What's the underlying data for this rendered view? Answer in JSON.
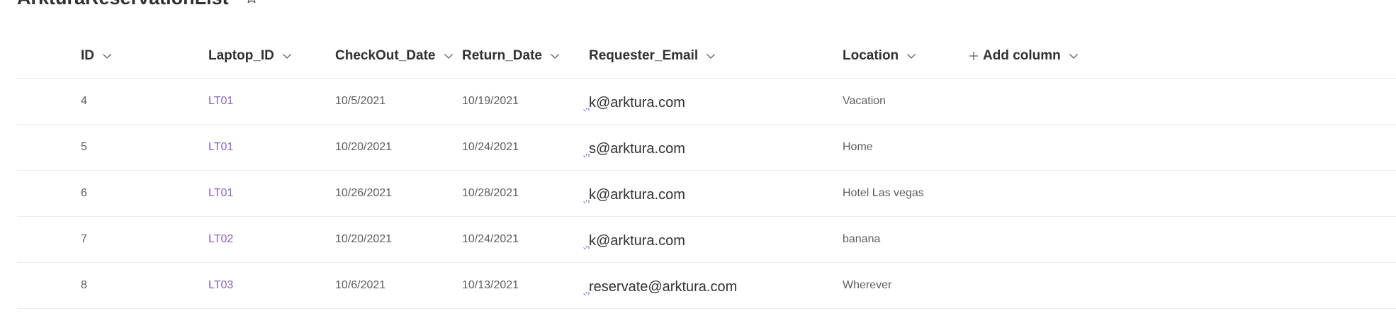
{
  "list": {
    "title": "ArkturaReservationList"
  },
  "columns": {
    "id": "ID",
    "laptop_id": "Laptop_ID",
    "checkout_date": "CheckOut_Date",
    "return_date": "Return_Date",
    "requester_email": "Requester_Email",
    "location": "Location",
    "add_column": "Add column"
  },
  "rows": [
    {
      "id": "4",
      "laptop_id": "LT01",
      "checkout_date": "10/5/2021",
      "return_date": "10/19/2021",
      "requester_email": "k@arktura.com",
      "location": "Vacation"
    },
    {
      "id": "5",
      "laptop_id": "LT01",
      "checkout_date": "10/20/2021",
      "return_date": "10/24/2021",
      "requester_email": "s@arktura.com",
      "location": "Home"
    },
    {
      "id": "6",
      "laptop_id": "LT01",
      "checkout_date": "10/26/2021",
      "return_date": "10/28/2021",
      "requester_email": "k@arktura.com",
      "location": "Hotel Las vegas"
    },
    {
      "id": "7",
      "laptop_id": "LT02",
      "checkout_date": "10/20/2021",
      "return_date": "10/24/2021",
      "requester_email": "k@arktura.com",
      "location": "banana"
    },
    {
      "id": "8",
      "laptop_id": "LT03",
      "checkout_date": "10/6/2021",
      "return_date": "10/13/2021",
      "requester_email": "reservate@arktura.com",
      "location": "Wherever"
    }
  ],
  "colors": {
    "accent": "#8764b8",
    "text_primary": "#323130",
    "text_secondary": "#605e5c",
    "divider": "#edebe9"
  },
  "icons": {
    "favorite": "star-outline-icon",
    "column_sort": "chevron-down-icon",
    "add": "plus-icon",
    "presence": "presence-loading-icon"
  }
}
